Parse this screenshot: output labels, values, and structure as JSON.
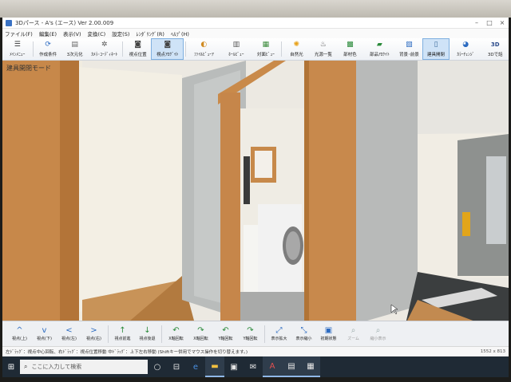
{
  "window": {
    "title": "3Dパース - A's (エース) Ver 2.00.009"
  },
  "menu": [
    "ファイル(F)",
    "編集(E)",
    "表示(V)",
    "変換(C)",
    "設定(S)",
    "ﾚﾝﾀﾞﾘﾝｸﾞ(R)",
    "ﾍﾙﾌﾟ(H)"
  ],
  "toolbar": [
    {
      "label": "ﾒｲﾝﾒﾆｭｰ",
      "icon": "menu-icon"
    },
    {
      "label": "作成条件",
      "icon": "settings-icon"
    },
    {
      "label": "3次元化",
      "icon": "cube-icon"
    },
    {
      "label": "ｶﾒﾗ･ｺｰﾃﾞｨﾈｰﾄ",
      "icon": "camera-coordinate-icon"
    },
    {
      "label": "視点位置",
      "icon": "camera-icon"
    },
    {
      "label": "視点ｱﾛｹﾞｲﾄ",
      "icon": "viewpoint-icon",
      "active": true
    },
    {
      "label": "ﾌｧｲﾙﾋﾞｭｰｱ",
      "icon": "file-viewer-icon"
    },
    {
      "label": "ﾎｰﾙﾋﾞｭｰ",
      "icon": "hall-view-icon"
    },
    {
      "label": "対面ﾋﾞｭｰ",
      "icon": "facing-view-icon"
    },
    {
      "label": "自然光",
      "icon": "sun-icon"
    },
    {
      "label": "光源一覧",
      "icon": "light-list-icon"
    },
    {
      "label": "部材色",
      "icon": "material-color-icon"
    },
    {
      "label": "部品ｱﾛｹｲﾄ",
      "icon": "parts-icon"
    },
    {
      "label": "背景･前景",
      "icon": "background-icon"
    },
    {
      "label": "建具開閉",
      "icon": "door-icon",
      "active": true
    },
    {
      "label": "ｶﾗｰﾁｪﾝｼﾞ",
      "icon": "color-change-icon"
    },
    {
      "label": "3Dで話",
      "icon": "3d-talk-icon"
    }
  ],
  "viewport": {
    "mode_label": "建具開閉モード"
  },
  "nav": [
    {
      "label": "視点(上)",
      "icon": "arrow-up-icon",
      "glyph": "^",
      "color": "blue"
    },
    {
      "label": "視点(下)",
      "icon": "arrow-down-icon",
      "glyph": "v",
      "color": "blue"
    },
    {
      "label": "視点(左)",
      "icon": "arrow-left-icon",
      "glyph": "<",
      "color": "blue"
    },
    {
      "label": "視点(右)",
      "icon": "arrow-right-icon",
      "glyph": ">",
      "color": "blue"
    },
    {
      "label": "視点前進",
      "icon": "move-forward-icon",
      "glyph": "↑",
      "color": "green"
    },
    {
      "label": "視点後退",
      "icon": "move-back-icon",
      "glyph": "↓",
      "color": "green"
    },
    {
      "label": "X軸回転",
      "icon": "rotate-x-icon",
      "glyph": "↶",
      "color": "green"
    },
    {
      "label": "X軸回転",
      "icon": "rotate-x-reverse-icon",
      "glyph": "↷",
      "color": "green"
    },
    {
      "label": "Y軸回転",
      "icon": "rotate-y-icon",
      "glyph": "↶",
      "color": "green"
    },
    {
      "label": "Y軸回転",
      "icon": "rotate-y-reverse-icon",
      "glyph": "↷",
      "color": "green"
    },
    {
      "label": "表示拡大",
      "icon": "zoom-in-icon",
      "glyph": "⤢",
      "color": "blue"
    },
    {
      "label": "表示縮小",
      "icon": "zoom-out-icon",
      "glyph": "⤡",
      "color": "blue"
    },
    {
      "label": "初期状態",
      "icon": "reset-view-icon",
      "glyph": "▣",
      "color": "blue"
    },
    {
      "label": "ズーム",
      "icon": "zoom-icon",
      "glyph": "⌕",
      "color": "gray",
      "dim": true
    },
    {
      "label": "縮小表示",
      "icon": "shrink-icon",
      "glyph": "⌕",
      "color": "gray",
      "dim": true
    }
  ],
  "status": {
    "hint": "左ﾄﾞﾗｯｸﾞ：視点中心回転、右ﾄﾞﾗｯｸﾞ：視点位置移動 中ﾄﾞﾗｯｸﾞ：上下左右移動 (Shiftキー併用でマウス操作を切り替えます。)",
    "resolution": "1552 x 813"
  },
  "taskbar": {
    "search_placeholder": "ここに入力して検索",
    "apps": [
      "task-view-icon",
      "edge-icon",
      "explorer-icon",
      "store-icon",
      "mail-icon",
      "app-a-icon",
      "app-b-icon",
      "3d-pers-icon"
    ]
  },
  "colors": {
    "accent": "#3a72c4",
    "active_tool": "#cfe3f7",
    "wood": "#c98a4a",
    "taskbar": "#1f2a35"
  }
}
